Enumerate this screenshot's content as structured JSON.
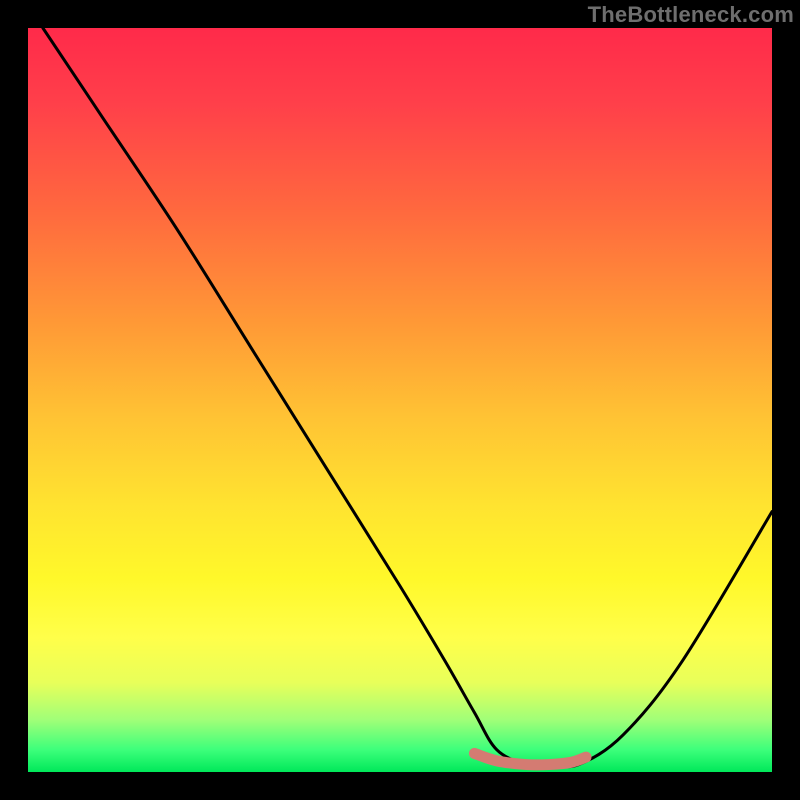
{
  "watermark": "TheBottleneck.com",
  "chart_data": {
    "type": "line",
    "title": "",
    "xlabel": "",
    "ylabel": "",
    "xlim": [
      0,
      100
    ],
    "ylim": [
      0,
      100
    ],
    "series": [
      {
        "name": "bottleneck-curve",
        "x": [
          2,
          10,
          20,
          30,
          40,
          50,
          56,
          60,
          63,
          67,
          70,
          74,
          80,
          88,
          100
        ],
        "y": [
          100,
          88,
          73,
          57,
          41,
          25,
          15,
          8,
          3,
          1,
          1,
          1,
          5,
          15,
          35
        ],
        "color": "#000000"
      },
      {
        "name": "optimal-range-marker",
        "x": [
          60,
          63,
          67,
          70,
          73,
          75
        ],
        "y": [
          2.5,
          1.5,
          1,
          1,
          1.3,
          2
        ],
        "color": "#d47b72"
      }
    ],
    "gradient_stops": [
      {
        "pos": 0,
        "color": "#ff2a4a"
      },
      {
        "pos": 10,
        "color": "#ff3f4a"
      },
      {
        "pos": 25,
        "color": "#ff6a3e"
      },
      {
        "pos": 40,
        "color": "#ff9a36"
      },
      {
        "pos": 52,
        "color": "#ffc234"
      },
      {
        "pos": 64,
        "color": "#ffe330"
      },
      {
        "pos": 74,
        "color": "#fff82a"
      },
      {
        "pos": 82,
        "color": "#ffff4a"
      },
      {
        "pos": 88,
        "color": "#e8ff5a"
      },
      {
        "pos": 93,
        "color": "#a0ff78"
      },
      {
        "pos": 97,
        "color": "#3dff7b"
      },
      {
        "pos": 100,
        "color": "#00e85a"
      }
    ]
  }
}
